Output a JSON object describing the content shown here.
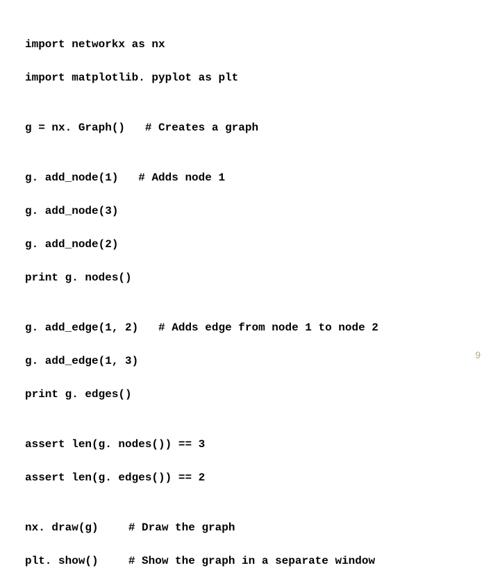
{
  "lines": {
    "l1": "import networkx as nx",
    "l2": "import matplotlib. pyplot as plt",
    "l3": "",
    "l4a": "g = nx. Graph()",
    "l4b": "# Creates a graph",
    "l5": "",
    "l6a": "g. add_node(1)",
    "l6b": "# Adds node 1",
    "l7": "g. add_node(3)",
    "l8": "g. add_node(2)",
    "l9": "print g. nodes()",
    "l10": "",
    "l11a": "g. add_edge(1, 2)",
    "l11b": "# Adds edge from node 1 to node 2",
    "l12": "g. add_edge(1, 3)",
    "l13": "print g. edges()",
    "l14": "",
    "l15": "assert len(g. nodes()) == 3",
    "l16": "assert len(g. edges()) == 2",
    "l17": "",
    "l18a": "nx. draw(g)",
    "l18b": "# Draw the graph",
    "l19a": "plt. show()",
    "l19b": "# Show the graph in a separate window"
  },
  "page_number": "9"
}
